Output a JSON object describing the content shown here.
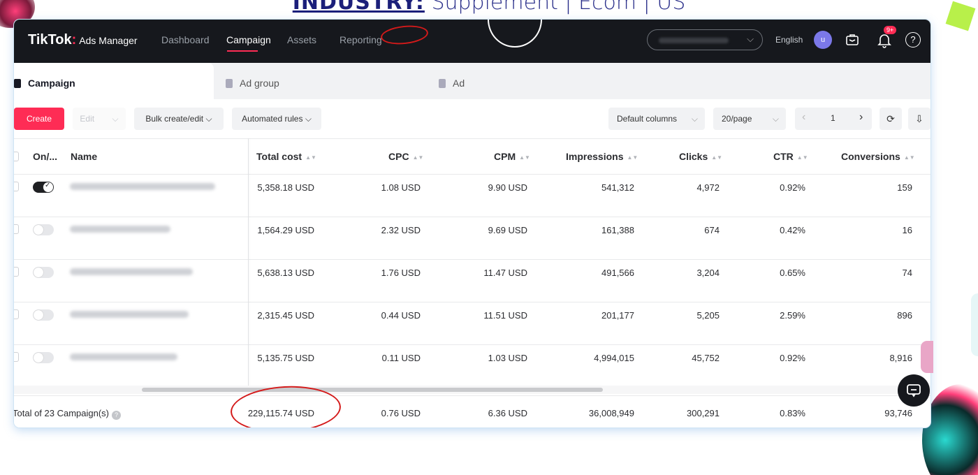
{
  "banner": {
    "bold": "INDUSTRY:",
    "rest": "  Supplement | Ecom | US"
  },
  "app": {
    "logo": "TikTok",
    "logo_colon": ":",
    "logo_sub": "Ads Manager"
  },
  "nav": {
    "items": [
      "Dashboard",
      "Campaign",
      "Assets",
      "Reporting"
    ],
    "active": "Campaign"
  },
  "header": {
    "language": "English",
    "avatar_letter": "u",
    "notification_badge": "9+",
    "account_chevron": "⌵",
    "help_glyph": "?"
  },
  "tabs": [
    {
      "label": "Campaign"
    },
    {
      "label": "Ad group"
    },
    {
      "label": "Ad"
    }
  ],
  "toolbar": {
    "create": "Create",
    "edit": "Edit",
    "bulk": "Bulk create/edit",
    "rules": "Automated rules",
    "columns": "Default columns",
    "per_page": "20/page",
    "page": "1",
    "prev": "‹",
    "next": "›",
    "refresh": "⟳",
    "export": "⇩",
    "chev": "⌵"
  },
  "columns": [
    "On/...",
    "Name",
    "Total cost",
    "CPC",
    "CPM",
    "Impressions",
    "Clicks",
    "CTR",
    "Conversions"
  ],
  "rows": [
    {
      "on": true,
      "total_cost": "5,358.18 USD",
      "cpc": "1.08 USD",
      "cpm": "9.90 USD",
      "impressions": "541,312",
      "clicks": "4,972",
      "ctr": "0.92%",
      "conversions": "159"
    },
    {
      "on": false,
      "total_cost": "1,564.29 USD",
      "cpc": "2.32 USD",
      "cpm": "9.69 USD",
      "impressions": "161,388",
      "clicks": "674",
      "ctr": "0.42%",
      "conversions": "16"
    },
    {
      "on": false,
      "total_cost": "5,638.13 USD",
      "cpc": "1.76 USD",
      "cpm": "11.47 USD",
      "impressions": "491,566",
      "clicks": "3,204",
      "ctr": "0.65%",
      "conversions": "74"
    },
    {
      "on": false,
      "total_cost": "2,315.45 USD",
      "cpc": "0.44 USD",
      "cpm": "11.51 USD",
      "impressions": "201,177",
      "clicks": "5,205",
      "ctr": "2.59%",
      "conversions": "896"
    },
    {
      "on": false,
      "total_cost": "5,135.75 USD",
      "cpc": "0.11 USD",
      "cpm": "1.03 USD",
      "impressions": "4,994,015",
      "clicks": "45,752",
      "ctr": "0.92%",
      "conversions": "8,916"
    }
  ],
  "footer": {
    "label": "Total of 23 Campaign(s)",
    "help": "?",
    "total_cost": "229,115.74 USD",
    "cpc": "0.76 USD",
    "cpm": "6.36 USD",
    "impressions": "36,008,949",
    "clicks": "300,291",
    "ctr": "0.83%",
    "conversions": "93,746"
  },
  "colors": {
    "brand": "#fe2c55",
    "topbar": "#16181d",
    "annotation": "#d41a1a"
  }
}
